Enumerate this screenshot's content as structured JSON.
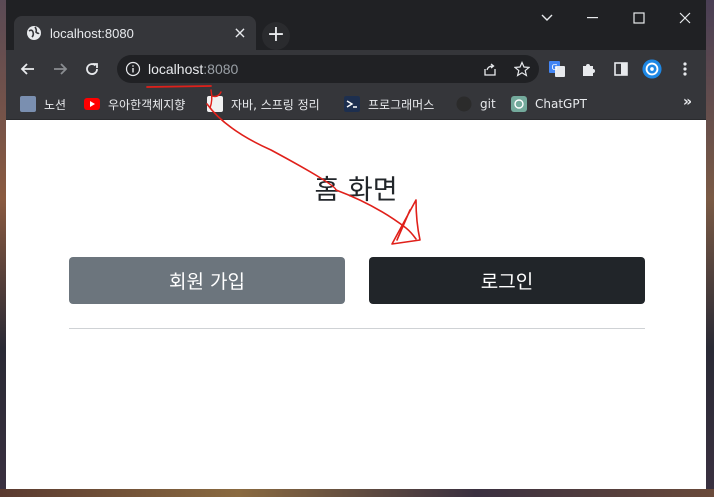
{
  "browser": {
    "tab": {
      "title": "localhost:8080",
      "favicon": "globe-icon",
      "close": "×"
    },
    "new_tab": "+",
    "address": {
      "host": "localhost",
      "port": ":8080"
    },
    "bookmarks": [
      {
        "label": "노션",
        "icon": "notion-icon",
        "color": "#7a8fb0"
      },
      {
        "label": "우아한객체지향",
        "icon": "youtube-icon",
        "color": "#ff0000"
      },
      {
        "label": "자바, 스프링 정리",
        "icon": "page-icon",
        "color": "#f1f1f1"
      },
      {
        "label": "프로그래머스",
        "icon": "programmers-icon",
        "color": "#1d2f4f"
      },
      {
        "label": "git",
        "icon": "github-icon",
        "color": "#2b2b2b"
      },
      {
        "label": "ChatGPT",
        "icon": "chatgpt-icon",
        "color": "#74aa9c"
      }
    ],
    "bookmarks_more": "»"
  },
  "page": {
    "title": "홈 화면",
    "signup_button": "회원 가입",
    "login_button": "로그인"
  },
  "colors": {
    "signup_bg": "#6c757d",
    "login_bg": "#212529",
    "annotation": "#e0201a"
  }
}
